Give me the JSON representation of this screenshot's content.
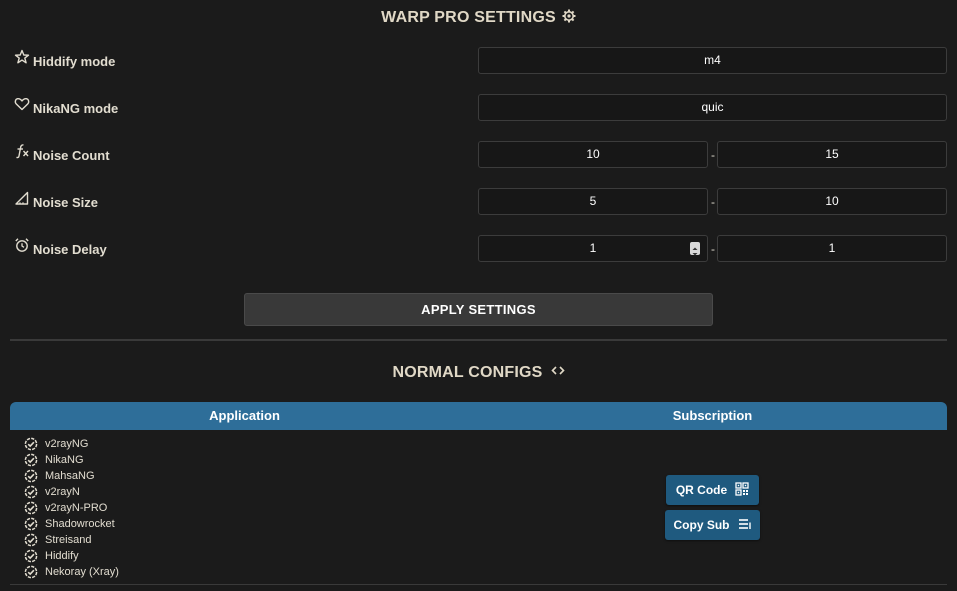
{
  "warp": {
    "title": "WARP PRO SETTINGS",
    "title_icon": "gear-icon",
    "rows": [
      {
        "label": "Hiddify mode",
        "icon": "star-icon",
        "value": "m4"
      },
      {
        "label": "NikaNG mode",
        "icon": "heart-icon",
        "value": "quic"
      },
      {
        "label": "Noise Count",
        "icon": "function-icon",
        "min": "10",
        "max": "15"
      },
      {
        "label": "Noise Size",
        "icon": "ruler-triangle-icon",
        "min": "5",
        "max": "10"
      },
      {
        "label": "Noise Delay",
        "icon": "alarm-clock-icon",
        "min": "1",
        "max": "1"
      }
    ],
    "separator": "-",
    "apply_label": "APPLY SETTINGS"
  },
  "normal": {
    "title": "NORMAL CONFIGS",
    "title_icon": "code-icon",
    "table": {
      "col_application": "Application",
      "col_subscription": "Subscription",
      "apps": [
        "v2rayNG",
        "NikaNG",
        "MahsaNG",
        "v2rayN",
        "v2rayN-PRO",
        "Shadowrocket",
        "Streisand",
        "Hiddify",
        "Nekoray (Xray)"
      ],
      "qr_label": "QR Code",
      "copy_label": "Copy Sub"
    }
  },
  "colors": {
    "background": "#1b1b1b",
    "table_header": "#2e6e99",
    "button_blue": "#1f5a7f",
    "apply_button": "#393939"
  }
}
